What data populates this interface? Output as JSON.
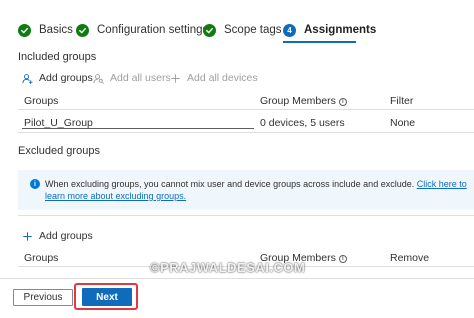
{
  "wizard": {
    "steps": [
      {
        "label": "Basics",
        "status": "complete"
      },
      {
        "label": "Configuration settings",
        "status": "complete"
      },
      {
        "label": "Scope tags",
        "status": "complete"
      },
      {
        "label": "Assignments",
        "status": "active",
        "number": "4"
      }
    ]
  },
  "included": {
    "title": "Included groups",
    "commands": {
      "add_groups": "Add groups",
      "add_all_users": "Add all users",
      "add_all_devices": "Add all devices"
    },
    "columns": {
      "groups": "Groups",
      "members": "Group Members",
      "filter": "Filter"
    },
    "rows": [
      {
        "group": "Pilot_U_Group",
        "members": "0 devices, 5 users",
        "filter": "None"
      }
    ]
  },
  "excluded": {
    "title": "Excluded groups",
    "info_text": "When excluding groups, you cannot mix user and device groups across include and exclude.",
    "info_link": "Click here to learn more about excluding groups.",
    "commands": {
      "add_groups": "Add groups"
    },
    "columns": {
      "groups": "Groups",
      "members": "Group Members",
      "remove": "Remove"
    }
  },
  "footer": {
    "previous": "Previous",
    "next": "Next"
  },
  "watermark": "©PRAJWALDESAI.COM",
  "colors": {
    "accent": "#0f6cbd",
    "success": "#107c10",
    "highlight": "#e0393e",
    "info_bg": "#eff6fc"
  }
}
